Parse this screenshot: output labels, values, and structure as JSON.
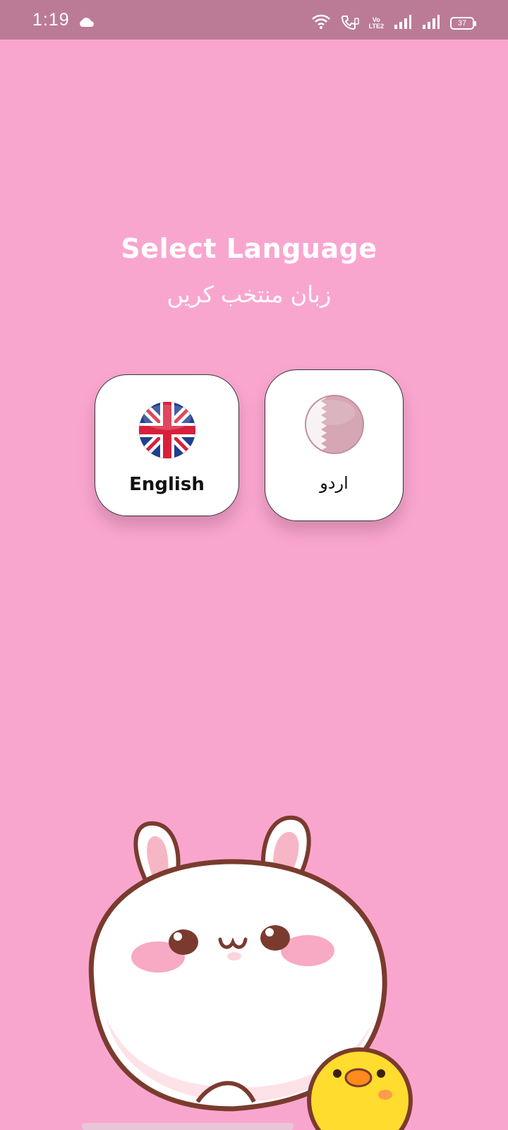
{
  "status": {
    "time": "1:19",
    "battery": "37",
    "volte_top": "Vo",
    "volte_bottom": "LTE2",
    "icons": [
      "cloud-icon",
      "wifi-icon",
      "wifi-call-icon",
      "volte-icon",
      "signal-icon",
      "signal-icon",
      "battery-icon"
    ]
  },
  "header": {
    "title_en": "Select Language",
    "title_ur": "زبان منتخب کریں"
  },
  "languages": [
    {
      "label": "English",
      "flag": "uk-flag-icon"
    },
    {
      "label": "اردو",
      "flag": "maroon-flag-icon"
    }
  ],
  "colors": {
    "background": "#f9a6cf",
    "status_bar": "#bb7b97",
    "card": "#ffffff",
    "text": "#111111"
  }
}
